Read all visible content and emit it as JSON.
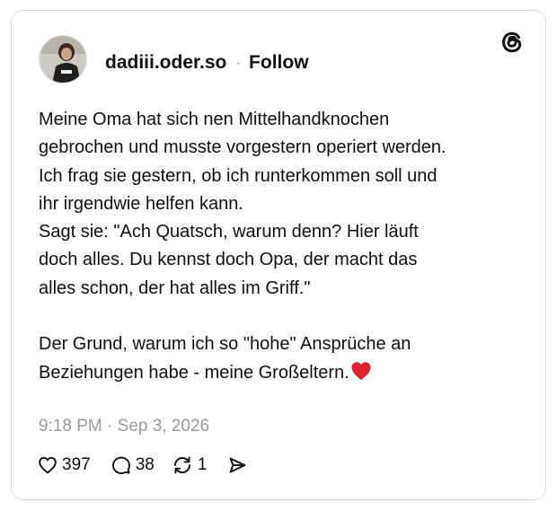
{
  "post": {
    "username": "dadiii.oder.so",
    "separator": "·",
    "follow_label": "Follow",
    "avatar_icon": "profile-photo",
    "text_lines": [
      "Meine Oma hat sich nen Mittelhandknochen",
      "gebrochen und musste vorgestern operiert werden.",
      "Ich frag sie gestern, ob ich runterkommen soll und",
      "ihr irgendwie helfen kann.",
      "Sagt sie: \"Ach Quatsch, warum denn? Hier läuft",
      "doch alles. Du kennst doch Opa, der macht das",
      "alles schon, der hat alles im Griff.\""
    ],
    "text_lines_2": [
      "Der Grund, warum ich so \"hohe\" Ansprüche an",
      "Beziehungen habe - meine Großeltern."
    ],
    "emoji": "red-heart",
    "timestamp": "9:18 PM · Sep 3, 2026",
    "stats": {
      "likes": "397",
      "replies": "38",
      "reposts": "1"
    }
  },
  "icons": {
    "platform_logo": "threads-logo-icon",
    "like": "heart-icon",
    "reply": "speech-bubble-icon",
    "repost": "repost-icon",
    "share": "send-icon"
  },
  "colors": {
    "text": "#101010",
    "muted": "#9a9a9a",
    "border": "#dcdcdc",
    "heart_emoji": "#e0202c"
  }
}
